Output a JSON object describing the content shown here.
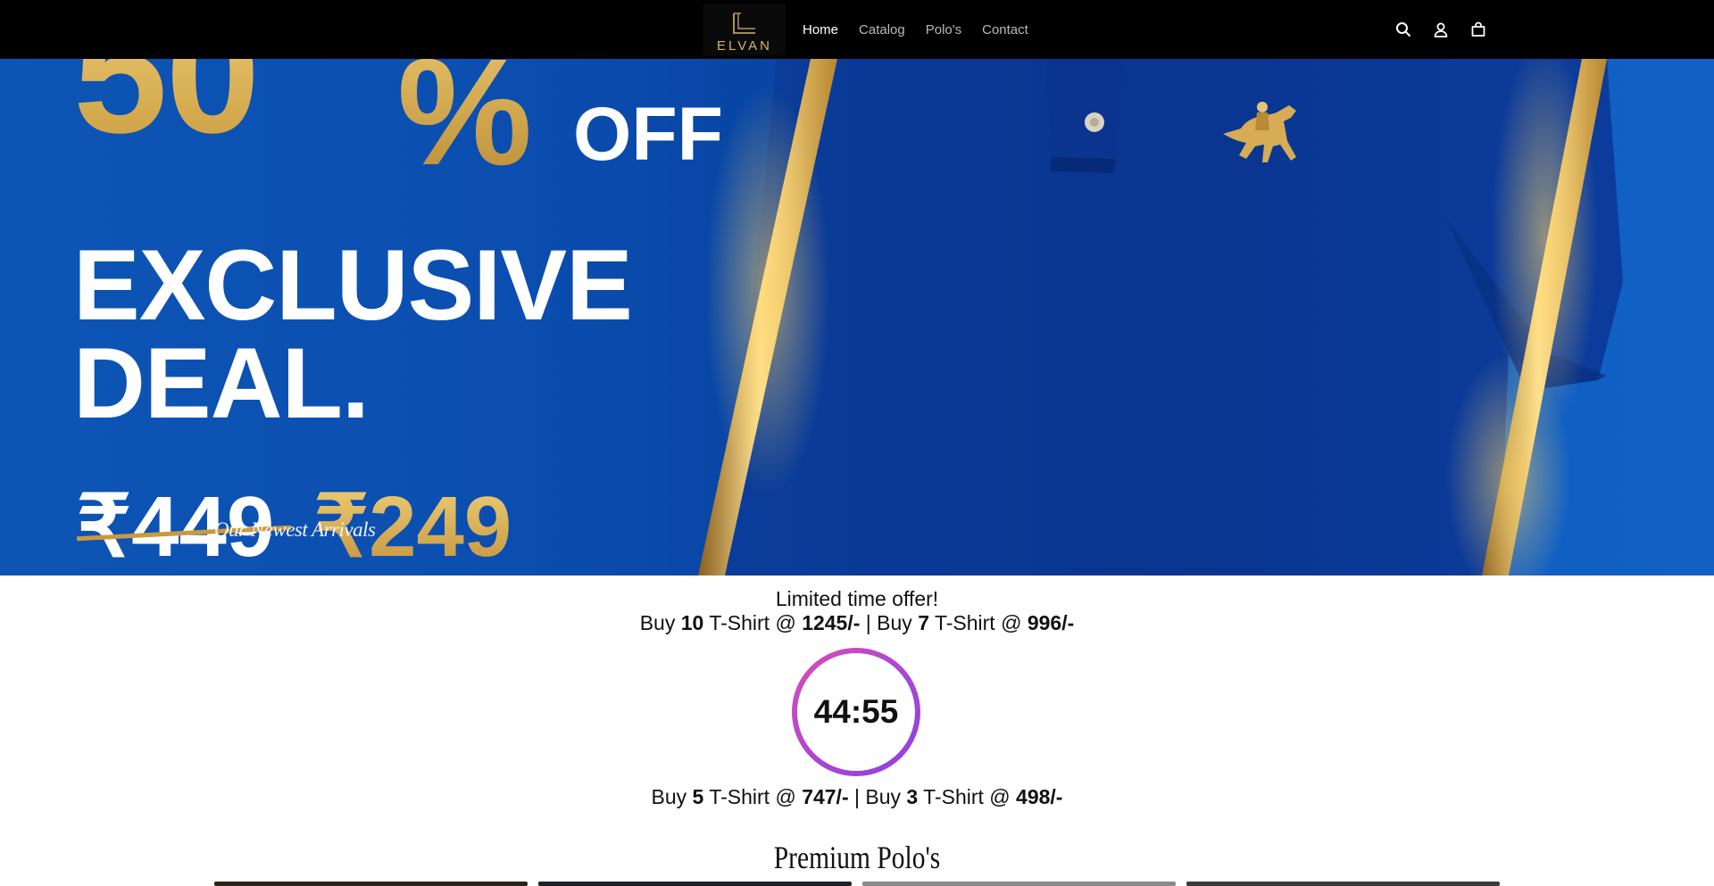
{
  "header": {
    "logo_text": "ELVAN",
    "nav": [
      {
        "label": "Home",
        "active": true
      },
      {
        "label": "Catalog",
        "active": false
      },
      {
        "label": "Polo's",
        "active": false
      },
      {
        "label": "Contact",
        "active": false
      }
    ],
    "icons": [
      "search-icon",
      "account-icon",
      "cart-icon"
    ]
  },
  "hero": {
    "discount_number": "50",
    "discount_percent": "%",
    "discount_off": "OFF",
    "headline_line_1": "EXCLUSIVE",
    "headline_line_2": "DEAL.",
    "old_price": "₹449",
    "new_price": "₹249",
    "caption": "Our Newest Arrivals"
  },
  "offer": {
    "title": "Limited time offer!",
    "line_1": {
      "p1": "Buy ",
      "qty1": "10",
      "p2": " T-Shirt @ ",
      "price1": "1245/-",
      "sep": " | Buy ",
      "qty2": "7",
      "p3": " T-Shirt @ ",
      "price2": "996/-"
    },
    "timer": "44:55",
    "line_2": {
      "p1": "Buy ",
      "qty1": "5",
      "p2": " T-Shirt @ ",
      "price1": "747/-",
      "sep": " | Buy ",
      "qty2": "3",
      "p3": " T-Shirt @ ",
      "price2": "498/-"
    }
  },
  "products_section": {
    "title": "Premium Polo's"
  },
  "colors": {
    "header_bg": "#000000",
    "gold": "#c99a3e",
    "hero_blue": "#0b4eb0",
    "timer_gradient_start": "#d94fae",
    "timer_gradient_end": "#8d3fe0"
  }
}
